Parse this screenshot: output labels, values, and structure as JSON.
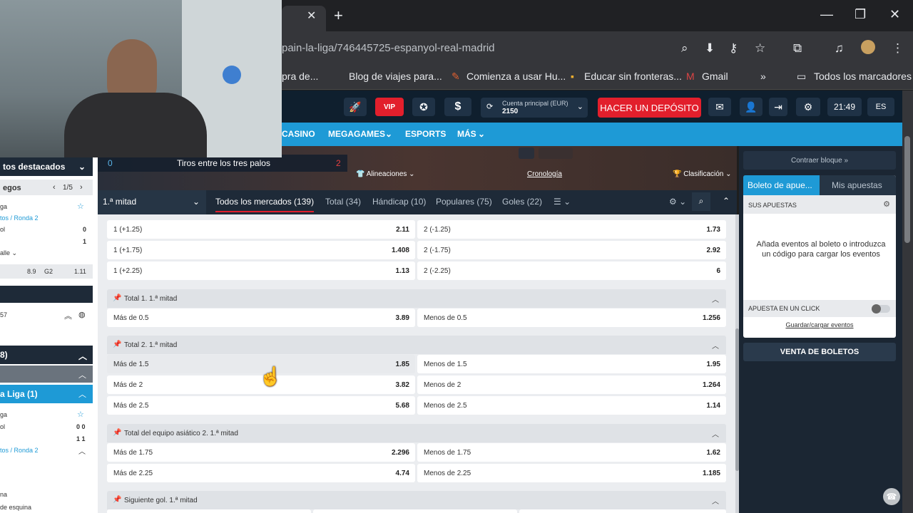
{
  "browser": {
    "url": "pain-la-liga/746445725-espanyol-real-madrid",
    "bookmarks": [
      "pra de...",
      "Blog de viajes para...",
      "Comienza a usar Hu...",
      "Educar sin fronteras...",
      "Gmail",
      "»",
      "Todos los marcadores"
    ]
  },
  "header": {
    "vip_label": "VIP",
    "account_label": "Cuenta principal (EUR)",
    "account_value": "2150",
    "deposit_label": "HACER UN DEPÓSITO",
    "time": "21:49",
    "lang": "ES"
  },
  "nav": {
    "items": [
      "CASINO",
      "MEGAGAMES",
      "ESPORTS",
      "MÁS"
    ]
  },
  "scoreboard": {
    "stat_left": "0",
    "stat_label": "Tiros entre los tres palos",
    "stat_right": "2",
    "lineups": "Alineaciones",
    "timeline": "Cronología",
    "standings": "Clasificación"
  },
  "market_tabs": {
    "period": "1.ª mitad",
    "tabs": [
      "Todos los mercados (139)",
      "Total (34)",
      "Hándicap (10)",
      "Populares (75)",
      "Goles (22)"
    ]
  },
  "markets": {
    "handicap_rows": [
      {
        "l_name": "1 (+1.25)",
        "l_odd": "2.11",
        "r_name": "2 (-1.25)",
        "r_odd": "1.73"
      },
      {
        "l_name": "1 (+1.75)",
        "l_odd": "1.408",
        "r_name": "2 (-1.75)",
        "r_odd": "2.92"
      },
      {
        "l_name": "1 (+2.25)",
        "l_odd": "1.13",
        "r_name": "2 (-2.25)",
        "r_odd": "6"
      }
    ],
    "groups": [
      {
        "title": "Total 1. 1.ª mitad",
        "rows": [
          {
            "l_name": "Más de 0.5",
            "l_odd": "3.89",
            "r_name": "Menos de 0.5",
            "r_odd": "1.256"
          }
        ]
      },
      {
        "title": "Total 2. 1.ª mitad",
        "rows": [
          {
            "l_name": "Más de 1.5",
            "l_odd": "1.85",
            "r_name": "Menos de 1.5",
            "r_odd": "1.95"
          },
          {
            "l_name": "Más de 2",
            "l_odd": "3.82",
            "r_name": "Menos de 2",
            "r_odd": "1.264"
          },
          {
            "l_name": "Más de 2.5",
            "l_odd": "5.68",
            "r_name": "Menos de 2.5",
            "r_odd": "1.14"
          }
        ]
      },
      {
        "title": "Total del equipo asiático 2. 1.ª mitad",
        "rows": [
          {
            "l_name": "Más de 1.75",
            "l_odd": "2.296",
            "r_name": "Menos de 1.75",
            "r_odd": "1.62"
          },
          {
            "l_name": "Más de 2.25",
            "l_odd": "4.74",
            "r_name": "Menos de 2.25",
            "r_odd": "1.185"
          }
        ]
      },
      {
        "title": "Siguiente gol. 1.ª mitad",
        "rows": []
      }
    ]
  },
  "betslip": {
    "collapse": "Contraer bloque",
    "tab_slip": "Boleto de apue...",
    "tab_bets": "Mis apuestas",
    "your_bets": "SUS APUESTAS",
    "empty_text": "Añada eventos al boleto o introduzca un código para cargar los eventos",
    "one_click": "APUESTA EN UN CLICK",
    "save_load": "Guardar/cargar eventos",
    "sell": "VENTA DE BOLETOS"
  },
  "left": {
    "featured": "tos destacados",
    "games": "egos",
    "pager": "1/5",
    "t1": "ga",
    "t2": "tos / Ronda 2",
    "t3": "ol",
    "s1": "0",
    "s2": "1",
    "detail": "alle",
    "odd1": "8.9",
    "g2": "G2",
    "odd2": "1.11",
    "t4": "57",
    "b1": "8)",
    "liga": "a Liga (1)",
    "t5": "ga",
    "t6": "ol",
    "s3": "0 0",
    "s4": "1 1",
    "t7": "tos / Ronda 2",
    "t8": "na",
    "t9": "de esquina"
  }
}
